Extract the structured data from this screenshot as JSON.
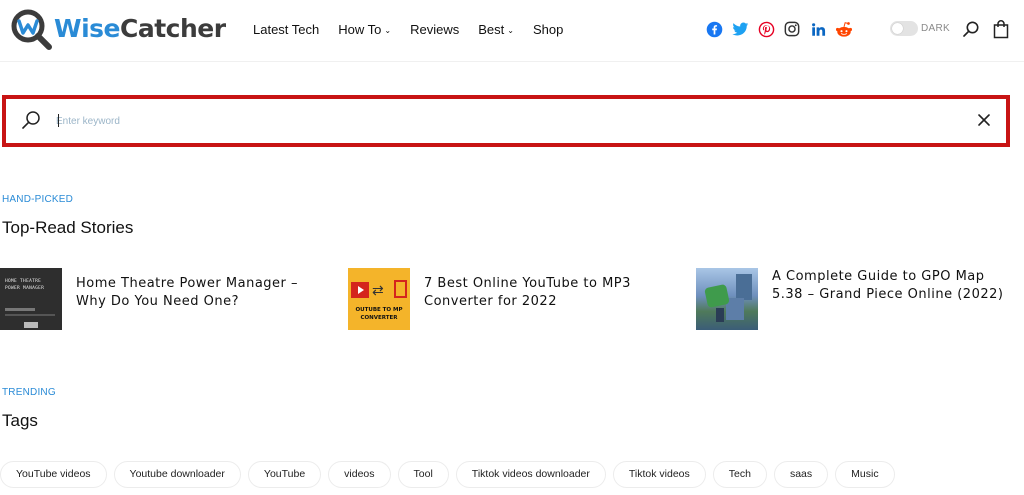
{
  "header": {
    "logo": {
      "first": "Wise",
      "second": "Catcher"
    },
    "nav": [
      {
        "label": "Latest Tech",
        "has_dropdown": false
      },
      {
        "label": "How To",
        "has_dropdown": true
      },
      {
        "label": "Reviews",
        "has_dropdown": false
      },
      {
        "label": "Best",
        "has_dropdown": true
      },
      {
        "label": "Shop",
        "has_dropdown": false
      }
    ],
    "dropdown_glyph": "⌄",
    "social": [
      {
        "icon": "facebook-icon",
        "color": "#1877f2"
      },
      {
        "icon": "twitter-icon",
        "color": "#1da1f2"
      },
      {
        "icon": "pinterest-icon",
        "color": "#e60023"
      },
      {
        "icon": "instagram-icon",
        "color": "#333333"
      },
      {
        "icon": "linkedin-icon",
        "color": "#0a66c2"
      },
      {
        "icon": "reddit-icon",
        "color": "#ff4500"
      }
    ],
    "dark_mode_label": "DARK"
  },
  "search": {
    "placeholder": "Enter keyword",
    "value": "",
    "highlight_color": "#c81414"
  },
  "hand_picked": {
    "eyebrow": "HAND-PICKED",
    "title": "Top-Read Stories",
    "stories": [
      {
        "title": "Home Theatre Power Manager – Why Do You Need One?",
        "thumb_text": "HOME THEATRE\nPOWER MANAGER"
      },
      {
        "title": "7 Best Online YouTube to MP3 Converter for 2022",
        "thumb_text": "OUTUBE TO MP\nCONVERTER"
      },
      {
        "title": "A Complete Guide to GPO Map 5.38 – Grand Piece Online (2022)"
      }
    ]
  },
  "trending": {
    "eyebrow": "TRENDING",
    "title": "Tags",
    "tags": [
      "YouTube videos",
      "Youtube downloader",
      "YouTube",
      "videos",
      "Tool",
      "Tiktok videos downloader",
      "Tiktok videos",
      "Tech",
      "saas",
      "Music"
    ]
  },
  "colors": {
    "accent": "#2a8bd6",
    "text": "#111111"
  }
}
